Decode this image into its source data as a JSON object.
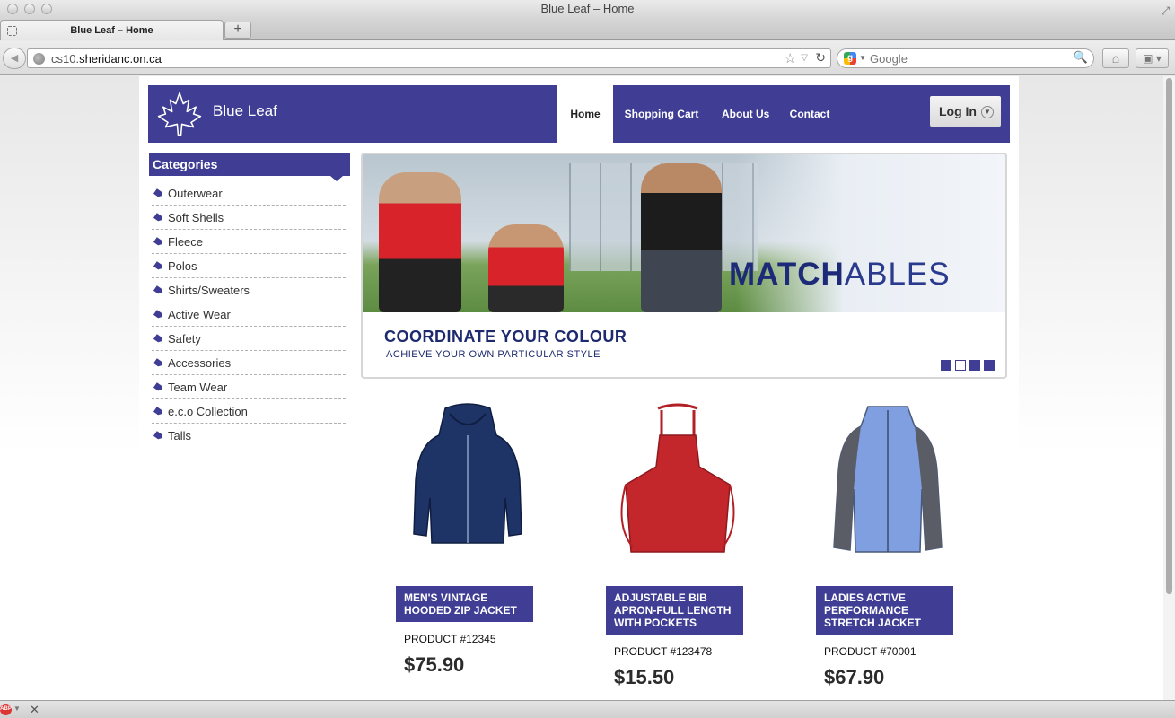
{
  "window": {
    "title": "Blue Leaf – Home"
  },
  "tabs": [
    {
      "label": "Blue Leaf – Home"
    }
  ],
  "newtab": {
    "label": "+"
  },
  "url": {
    "prefix": "cs10.",
    "host": "sheridanc.on.ca"
  },
  "search": {
    "placeholder": "Google"
  },
  "site": {
    "brand": "Blue Leaf",
    "nav": [
      {
        "label": "Home"
      },
      {
        "label": "Shopping Cart"
      },
      {
        "label": "About Us"
      },
      {
        "label": "Contact"
      }
    ],
    "login": "Log In"
  },
  "categories": {
    "title": "Categories",
    "items": [
      "Outerwear",
      "Soft Shells",
      "Fleece",
      "Polos",
      "Shirts/Sweaters",
      "Active Wear",
      "Safety",
      "Accessories",
      "Team Wear",
      "e.c.o Collection",
      "Talls"
    ]
  },
  "banner": {
    "brand_bold": "MATCH",
    "brand_light": "ABLES",
    "title": "COORDINATE YOUR COLOUR",
    "subtitle": "ACHIEVE YOUR OWN PARTICULAR STYLE",
    "slides": 4,
    "active_slide": 2
  },
  "products": [
    {
      "name": "Men's Vintage Hooded Zip Jacket",
      "number": "PRODUCT #12345",
      "price": "$75.90",
      "color": "#1e3466"
    },
    {
      "name": "Adjustable Bib Apron-Full Length With Pockets",
      "number": "PRODUCT #123478",
      "price": "$15.50",
      "color": "#c3262b"
    },
    {
      "name": "Ladies Active Performance Stretch Jacket",
      "number": "PRODUCT #70001",
      "price": "$67.90",
      "color": "#7f9fe0"
    }
  ],
  "status": {
    "abp": "ABP"
  },
  "colors": {
    "brand": "#3f3d94"
  }
}
